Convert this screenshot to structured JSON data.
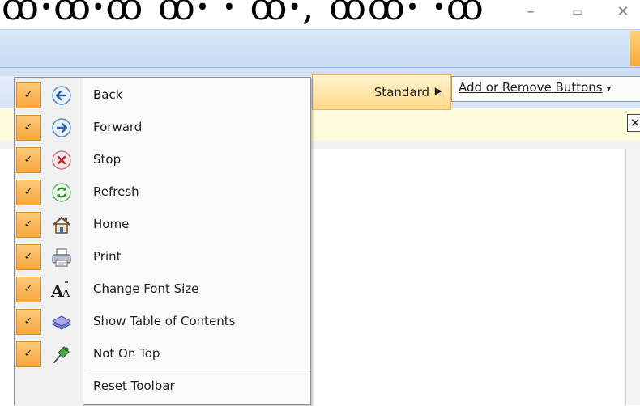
{
  "window": {
    "cropped_text": "ꝏꞏꝏꞏꝏ ꝏꞏ ꞏ ꝏꞏ, ꝏꝏꞏ ꞏꝏ",
    "minimize_glyph": "–",
    "restore_glyph": "▭",
    "close_glyph": "✕"
  },
  "menu": {
    "standard_item": {
      "label": "Standard",
      "arrow": "▶"
    },
    "add_remove_item": {
      "label": "Add or Remove Buttons",
      "arrow": "▾"
    },
    "items": [
      {
        "label": "Back",
        "checked": true,
        "icon": "back-arrow-icon"
      },
      {
        "label": "Forward",
        "checked": true,
        "icon": "forward-arrow-icon"
      },
      {
        "label": "Stop",
        "checked": true,
        "icon": "stop-icon"
      },
      {
        "label": "Refresh",
        "checked": true,
        "icon": "refresh-icon"
      },
      {
        "label": "Home",
        "checked": true,
        "icon": "home-icon"
      },
      {
        "label": "Print",
        "checked": true,
        "icon": "printer-icon"
      },
      {
        "label": "Change Font Size",
        "checked": true,
        "icon": "font-size-icon"
      },
      {
        "label": "Show Table of Contents",
        "checked": true,
        "icon": "table-of-contents-icon"
      },
      {
        "label": "Not On Top",
        "checked": true,
        "icon": "pin-icon"
      }
    ],
    "reset_label": "Reset Toolbar",
    "check_glyph": "✓"
  },
  "info_bar": {
    "close_glyph": "✕"
  },
  "colors": {
    "menu_highlight": "#ffd98a",
    "check_bg": "#f6a53b",
    "ribbon": "#c4d9f2"
  }
}
